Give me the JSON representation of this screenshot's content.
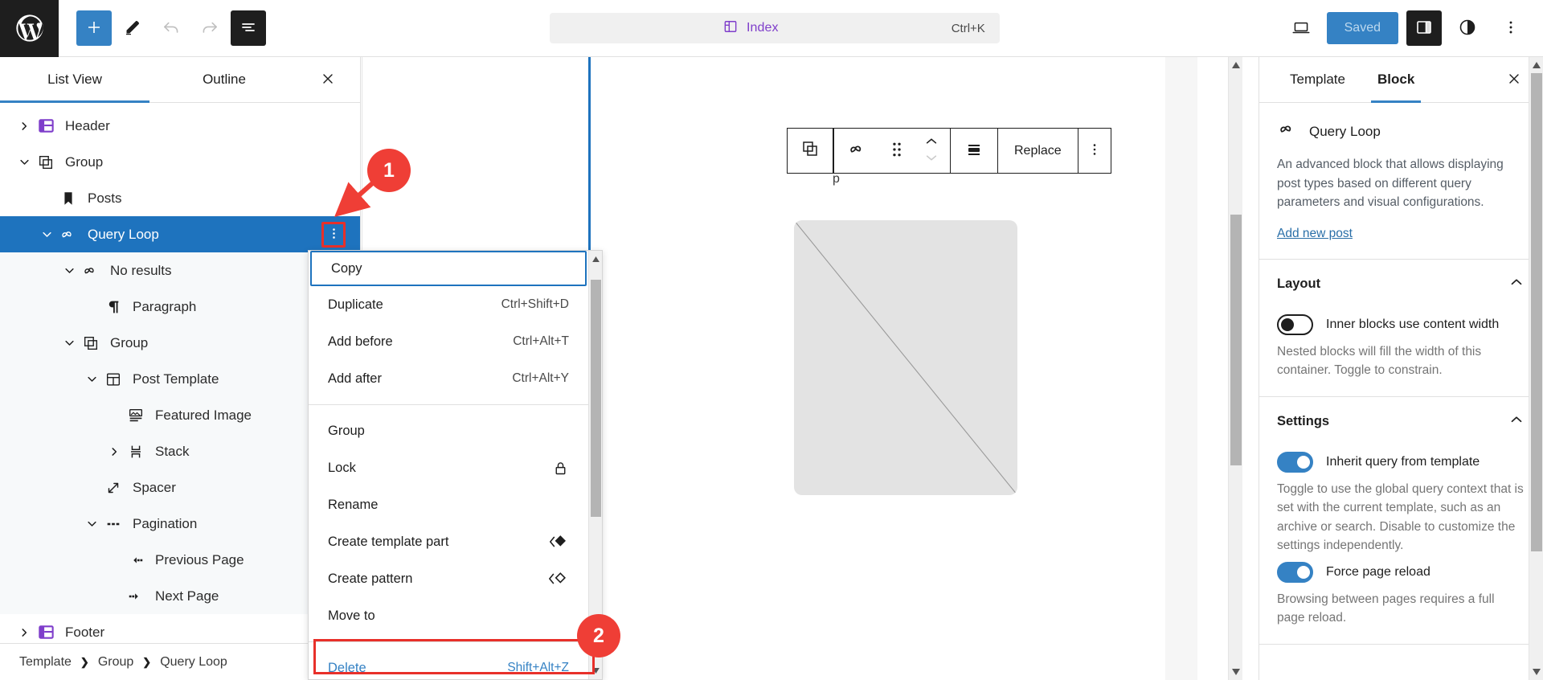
{
  "topbar": {
    "logo_icon": "wordpress-logo-icon",
    "add_block_label": "+",
    "tools": [
      {
        "name": "add-block-button",
        "icon": "plus-icon",
        "style": "primary"
      },
      {
        "name": "edit-tool-button",
        "icon": "pencil-icon",
        "style": "plain"
      },
      {
        "name": "undo-button",
        "icon": "undo-icon",
        "style": "disabled"
      },
      {
        "name": "redo-button",
        "icon": "redo-icon",
        "style": "disabled"
      },
      {
        "name": "document-overview-button",
        "icon": "list-view-icon",
        "style": "dark"
      }
    ],
    "document_title": "Index",
    "document_shortcut": "Ctrl+K",
    "view_icon": "laptop-icon",
    "save_label": "Saved",
    "settings_sidebar_icon": "sidebar-panel-icon",
    "styles_icon": "contrast-half-circle-icon",
    "options_icon": "three-dots-vertical-icon"
  },
  "list_view": {
    "tabs": [
      {
        "label": "List View",
        "active": true
      },
      {
        "label": "Outline",
        "active": false
      }
    ],
    "close_icon": "close-icon",
    "rows": [
      {
        "label": "Header",
        "icon": "template-part-icon",
        "indent": 0,
        "chevron": "right",
        "shaded": false,
        "selected": false
      },
      {
        "label": "Group",
        "icon": "group-icon",
        "indent": 0,
        "chevron": "down",
        "shaded": false,
        "selected": false
      },
      {
        "label": "Posts",
        "icon": "bookmark-icon",
        "indent": 1,
        "chevron": "none",
        "shaded": false,
        "selected": false
      },
      {
        "label": "Query Loop",
        "icon": "loop-icon",
        "indent": 1,
        "chevron": "down",
        "shaded": false,
        "selected": true
      },
      {
        "label": "No results",
        "icon": "loop-icon",
        "indent": 2,
        "chevron": "down",
        "shaded": true,
        "selected": false
      },
      {
        "label": "Paragraph",
        "icon": "paragraph-icon",
        "indent": 3,
        "chevron": "none",
        "shaded": true,
        "selected": false
      },
      {
        "label": "Group",
        "icon": "group-icon",
        "indent": 2,
        "chevron": "down",
        "shaded": true,
        "selected": false
      },
      {
        "label": "Post Template",
        "icon": "post-template-icon",
        "indent": 3,
        "chevron": "down",
        "shaded": true,
        "selected": false
      },
      {
        "label": "Featured Image",
        "icon": "featured-image-icon",
        "indent": 4,
        "chevron": "none",
        "shaded": true,
        "selected": false
      },
      {
        "label": "Stack",
        "icon": "stack-icon",
        "indent": 4,
        "chevron": "right",
        "shaded": true,
        "selected": false
      },
      {
        "label": "Spacer",
        "icon": "spacer-icon",
        "indent": 3,
        "chevron": "none",
        "shaded": true,
        "selected": false
      },
      {
        "label": "Pagination",
        "icon": "pagination-icon",
        "indent": 3,
        "chevron": "down",
        "shaded": true,
        "selected": false
      },
      {
        "label": "Previous Page",
        "icon": "previous-page-icon",
        "indent": 4,
        "chevron": "none",
        "shaded": true,
        "selected": false
      },
      {
        "label": "Next Page",
        "icon": "next-page-icon",
        "indent": 4,
        "chevron": "none",
        "shaded": true,
        "selected": false
      },
      {
        "label": "Footer",
        "icon": "template-part-icon",
        "indent": 0,
        "chevron": "right",
        "shaded": false,
        "selected": false
      }
    ],
    "selected_row_kebab_icon": "three-dots-vertical-icon",
    "breadcrumb": [
      "Template",
      "Group",
      "Query Loop"
    ]
  },
  "block_toolbar": {
    "parent_icon": "group-icon",
    "block_icon": "loop-icon",
    "drag_icon": "drag-handle-icon",
    "move_up_icon": "chevron-up-icon",
    "move_down_icon": "chevron-down-icon",
    "align_icon": "align-center-icon",
    "replace_label": "Replace",
    "options_icon": "three-dots-vertical-icon"
  },
  "menu": {
    "items": [
      {
        "label": "Copy",
        "shortcut": "",
        "focused": true,
        "highlighted": false,
        "icon": ""
      },
      {
        "label": "Duplicate",
        "shortcut": "Ctrl+Shift+D",
        "focused": false,
        "highlighted": false,
        "icon": ""
      },
      {
        "label": "Add before",
        "shortcut": "Ctrl+Alt+T",
        "focused": false,
        "highlighted": false,
        "icon": ""
      },
      {
        "label": "Add after",
        "shortcut": "Ctrl+Alt+Y",
        "focused": false,
        "highlighted": false,
        "icon": ""
      },
      {
        "separator": true
      },
      {
        "label": "Group",
        "shortcut": "",
        "focused": false,
        "highlighted": false,
        "icon": ""
      },
      {
        "label": "Lock",
        "shortcut": "",
        "focused": false,
        "highlighted": false,
        "icon": "lock-icon"
      },
      {
        "label": "Rename",
        "shortcut": "",
        "focused": false,
        "highlighted": false,
        "icon": ""
      },
      {
        "label": "Create template part",
        "shortcut": "",
        "focused": false,
        "highlighted": false,
        "icon": "template-part-create-icon"
      },
      {
        "label": "Create pattern",
        "shortcut": "",
        "focused": false,
        "highlighted": false,
        "icon": "pattern-create-icon"
      },
      {
        "label": "Move to",
        "shortcut": "",
        "focused": false,
        "highlighted": false,
        "icon": ""
      },
      {
        "separator": true
      },
      {
        "label": "Delete",
        "shortcut": "Shift+Alt+Z",
        "focused": false,
        "highlighted": true,
        "icon": ""
      }
    ]
  },
  "inspector": {
    "tabs": [
      {
        "label": "Template",
        "active": false
      },
      {
        "label": "Block",
        "active": true
      }
    ],
    "close_icon": "close-icon",
    "block": {
      "icon": "loop-icon",
      "name": "Query Loop",
      "description": "An advanced block that allows displaying post types based on different query parameters and visual configurations.",
      "link_label": "Add new post"
    },
    "panels": [
      {
        "title": "Layout",
        "collapse_icon": "chevron-up-icon",
        "controls": [
          {
            "type": "toggle",
            "label": "Inner blocks use content width",
            "on": false,
            "help": "Nested blocks will fill the width of this container. Toggle to constrain."
          }
        ]
      },
      {
        "title": "Settings",
        "collapse_icon": "chevron-up-icon",
        "controls": [
          {
            "type": "toggle",
            "label": "Inherit query from template",
            "on": true,
            "help": "Toggle to use the global query context that is set with the current template, such as an archive or search. Disable to customize the settings independently."
          },
          {
            "type": "toggle",
            "label": "Force page reload",
            "on": true,
            "help": "Browsing between pages requires a full page reload."
          }
        ]
      }
    ]
  },
  "annotations": [
    {
      "number": "1",
      "target": "list-view-kebab-button"
    },
    {
      "number": "2",
      "target": "delete-menu-item"
    }
  ],
  "colors": {
    "accent_blue": "#3582c4",
    "selected_row": "#1e73be",
    "annotation_red": "#ef3e36",
    "highlight_red": "#e8302a",
    "purple": "#7f3ecb",
    "dark": "#1e1e1e"
  }
}
